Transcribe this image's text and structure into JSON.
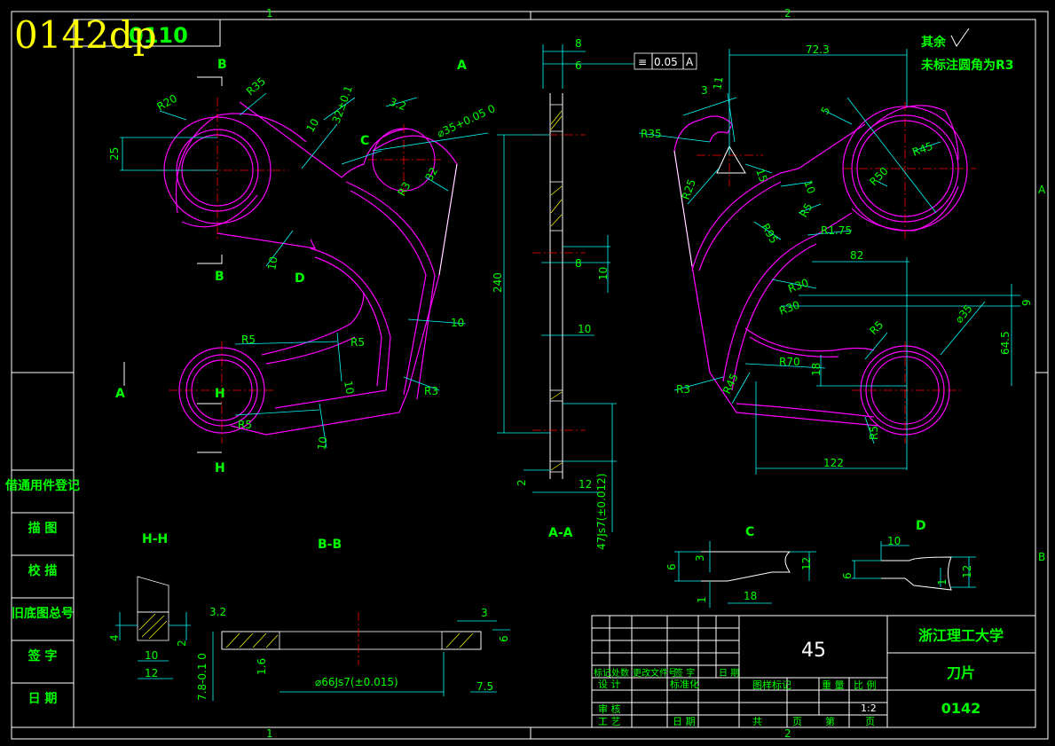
{
  "overlay": {
    "stamp": "0142dp",
    "corner_code": "0110"
  },
  "zones": {
    "top_1": "1",
    "top_2": "2",
    "side_a": "A",
    "side_b": "B",
    "bottom_1": "1",
    "bottom_2": "2"
  },
  "views": {
    "hh": "H-H",
    "bb": "B-B",
    "aa": "A-A",
    "c": "C",
    "d": "D",
    "mark_b": "B",
    "mark_a": "A",
    "mark_h": "H",
    "mark_c": "C",
    "mark_d": "D"
  },
  "notes": {
    "rest": "其余",
    "fillet": "未标注圆角为R3"
  },
  "tolerance_frame": {
    "symbol": "≡",
    "value": "0.05",
    "datum": "A"
  },
  "left_dims": {
    "r20": "R20",
    "r35": "R35",
    "d25": "25",
    "d10a": "10",
    "d32": "32±0.1",
    "r3_2": "3.2",
    "phi35": "⌀35+0.05 0",
    "r53": "R3",
    "d32b": "32",
    "d10b": "10",
    "d10c": "10",
    "r5a": "R5",
    "r5b": "R5",
    "d10d": "10",
    "r3": "R3",
    "r5c": "R5",
    "d10e": "10"
  },
  "mid_dims": {
    "d8": "8",
    "d6": "6",
    "d240": "240",
    "d8b": "8",
    "d10": "10",
    "d10b": "10",
    "d2": "2",
    "d12": "12",
    "d47": "47Js7(±0.012)"
  },
  "right_dims": {
    "d72_3": "72.3",
    "d3": "3",
    "d11": "11",
    "d5": "5",
    "r35": "R35",
    "r25": "R25",
    "d15": "15",
    "r45": "R45",
    "r50": "R50",
    "d10": "10",
    "r5": "R5",
    "r1_75": "R1.75",
    "r95": "R95",
    "d82": "82",
    "r30": "R30",
    "r30b": "R30",
    "d9": "9",
    "phi35": "⌀35",
    "r5b": "R5",
    "d64_5": "64.5",
    "r70": "R70",
    "d18": "18",
    "r3": "R3",
    "r45b": "R45",
    "r5c": "R5",
    "d122": "122"
  },
  "sections": {
    "hh": {
      "d4": "4",
      "d2": "2",
      "d10": "10",
      "d12": "12"
    },
    "bb": {
      "r3_2": "3.2",
      "d1_6": "1.6",
      "d78": "7.8-0.1 0",
      "phi66": "⌀66Js7(±0.015)",
      "d3": "3",
      "d6": "6",
      "d7_5": "7.5"
    },
    "c": {
      "d6": "6",
      "d3": "3",
      "d12": "12",
      "d18": "18",
      "d1": "1"
    },
    "d": {
      "d10": "10",
      "d6": "6",
      "d1": "1",
      "d12": "12"
    }
  },
  "side_table": {
    "rows": [
      "借通用件登记",
      "描 图",
      "校 描",
      "旧底图总号",
      "签 字",
      "日 期"
    ]
  },
  "title_block": {
    "material": "45",
    "university": "浙江理工大学",
    "part_name": "刀片",
    "drawing_no": "0142",
    "rev_headers": [
      "标记",
      "处数",
      "更改文件号",
      "签 字",
      "日 期"
    ],
    "design": "设 计",
    "standard": "标准化",
    "review": "审 核",
    "process": "工 艺",
    "date": "日 期",
    "stage_mark": "图样标记",
    "weight": "重 量",
    "scale_label": "比 例",
    "scale": "1:2",
    "total": "共",
    "sheet": "页",
    "num": "第",
    "page": "页"
  }
}
